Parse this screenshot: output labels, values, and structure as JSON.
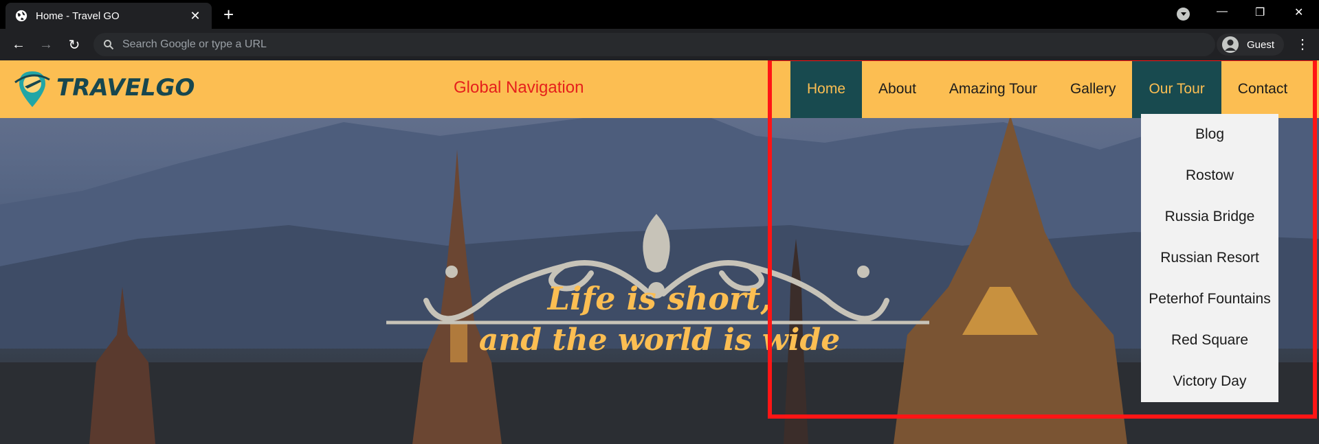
{
  "browser": {
    "tab_title": "Home - Travel GO",
    "close_tab": "✕",
    "new_tab": "+",
    "omnibox_placeholder": "Search Google or type a URL",
    "profile_label": "Guest",
    "menu_glyph": "⋮",
    "window_controls": {
      "minimize": "—",
      "restore": "❐",
      "close": "✕"
    },
    "nav_glyphs": {
      "back": "←",
      "forward": "→",
      "reload": "↻"
    }
  },
  "site": {
    "logo_text": "TRAVELGO",
    "header_caption": "Global Navigation",
    "menu": [
      {
        "label": "Home",
        "active": true
      },
      {
        "label": "About",
        "active": false
      },
      {
        "label": "Amazing Tour",
        "active": false
      },
      {
        "label": "Gallery",
        "active": false
      },
      {
        "label": "Our Tour",
        "active": true
      },
      {
        "label": "Contact",
        "active": false
      }
    ],
    "dropdown": [
      "Blog",
      "Rostow",
      "Russia Bridge",
      "Russian Resort",
      "Peterhof Fountains",
      "Red Square",
      "Victory Day"
    ],
    "tagline": [
      "Life is short,",
      "and the world is wide"
    ]
  },
  "colors": {
    "header_bg": "#fcbe52",
    "active_bg": "#184a4f",
    "active_text": "#fcbe52",
    "caption": "#e5201c",
    "highlight": "#ff1515"
  }
}
